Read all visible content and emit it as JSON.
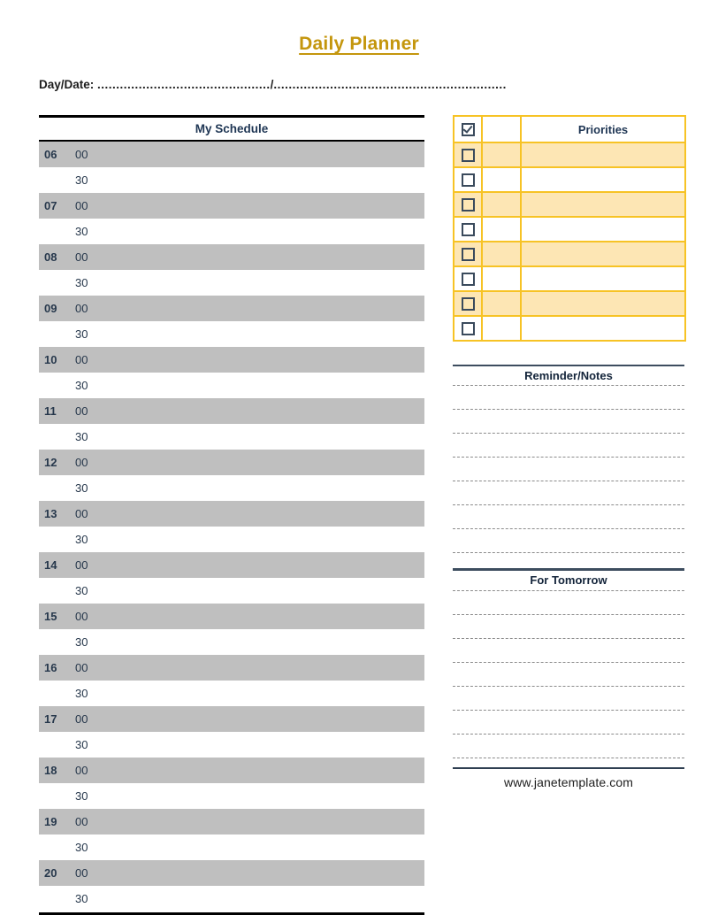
{
  "document": {
    "title": "Daily Planner",
    "title_color": "#c4960d"
  },
  "daydate": {
    "label": "Day/Date:",
    "dots_left": "..............................................",
    "separator": "/",
    "dots_right": ".............................................................."
  },
  "schedule": {
    "heading": "My Schedule",
    "row_background_hour": "#bfbfbf",
    "row_background_half": "#ffffff",
    "rows": [
      {
        "hour": "06",
        "minute": "00",
        "type": "hour"
      },
      {
        "hour": "",
        "minute": "30",
        "type": "half"
      },
      {
        "hour": "07",
        "minute": "00",
        "type": "hour"
      },
      {
        "hour": "",
        "minute": "30",
        "type": "half"
      },
      {
        "hour": "08",
        "minute": "00",
        "type": "hour"
      },
      {
        "hour": "",
        "minute": "30",
        "type": "half"
      },
      {
        "hour": "09",
        "minute": "00",
        "type": "hour"
      },
      {
        "hour": "",
        "minute": "30",
        "type": "half"
      },
      {
        "hour": "10",
        "minute": "00",
        "type": "hour"
      },
      {
        "hour": "",
        "minute": "30",
        "type": "half"
      },
      {
        "hour": "11",
        "minute": "00",
        "type": "hour"
      },
      {
        "hour": "",
        "minute": "30",
        "type": "half"
      },
      {
        "hour": "12",
        "minute": "00",
        "type": "hour"
      },
      {
        "hour": "",
        "minute": "30",
        "type": "half"
      },
      {
        "hour": "13",
        "minute": "00",
        "type": "hour"
      },
      {
        "hour": "",
        "minute": "30",
        "type": "half"
      },
      {
        "hour": "14",
        "minute": "00",
        "type": "hour"
      },
      {
        "hour": "",
        "minute": "30",
        "type": "half"
      },
      {
        "hour": "15",
        "minute": "00",
        "type": "hour"
      },
      {
        "hour": "",
        "minute": "30",
        "type": "half"
      },
      {
        "hour": "16",
        "minute": "00",
        "type": "hour"
      },
      {
        "hour": "",
        "minute": "30",
        "type": "half"
      },
      {
        "hour": "17",
        "minute": "00",
        "type": "hour"
      },
      {
        "hour": "",
        "minute": "30",
        "type": "half"
      },
      {
        "hour": "18",
        "minute": "00",
        "type": "hour"
      },
      {
        "hour": "",
        "minute": "30",
        "type": "half"
      },
      {
        "hour": "19",
        "minute": "00",
        "type": "hour"
      },
      {
        "hour": "",
        "minute": "30",
        "type": "half"
      },
      {
        "hour": "20",
        "minute": "00",
        "type": "hour"
      },
      {
        "hour": "",
        "minute": "30",
        "type": "half"
      }
    ]
  },
  "priorities": {
    "heading": "Priorities",
    "border_color": "#f7c325",
    "tint_color": "#fde6b4",
    "header_checkbox_checked": true,
    "rows": [
      {
        "checked": false,
        "middle": "",
        "text": "",
        "tinted": true
      },
      {
        "checked": false,
        "middle": "",
        "text": "",
        "tinted": false
      },
      {
        "checked": false,
        "middle": "",
        "text": "",
        "tinted": true
      },
      {
        "checked": false,
        "middle": "",
        "text": "",
        "tinted": false
      },
      {
        "checked": false,
        "middle": "",
        "text": "",
        "tinted": true
      },
      {
        "checked": false,
        "middle": "",
        "text": "",
        "tinted": false
      },
      {
        "checked": false,
        "middle": "",
        "text": "",
        "tinted": true
      },
      {
        "checked": false,
        "middle": "",
        "text": "",
        "tinted": false
      }
    ]
  },
  "reminder_notes": {
    "heading": "Reminder/Notes",
    "line_count": 8,
    "lines": [
      "",
      "",
      "",
      "",
      "",
      "",
      "",
      ""
    ]
  },
  "for_tomorrow": {
    "heading": "For Tomorrow",
    "line_count": 8,
    "lines": [
      "",
      "",
      "",
      "",
      "",
      "",
      "",
      ""
    ]
  },
  "footer": {
    "url": "www.janetemplate.com"
  }
}
